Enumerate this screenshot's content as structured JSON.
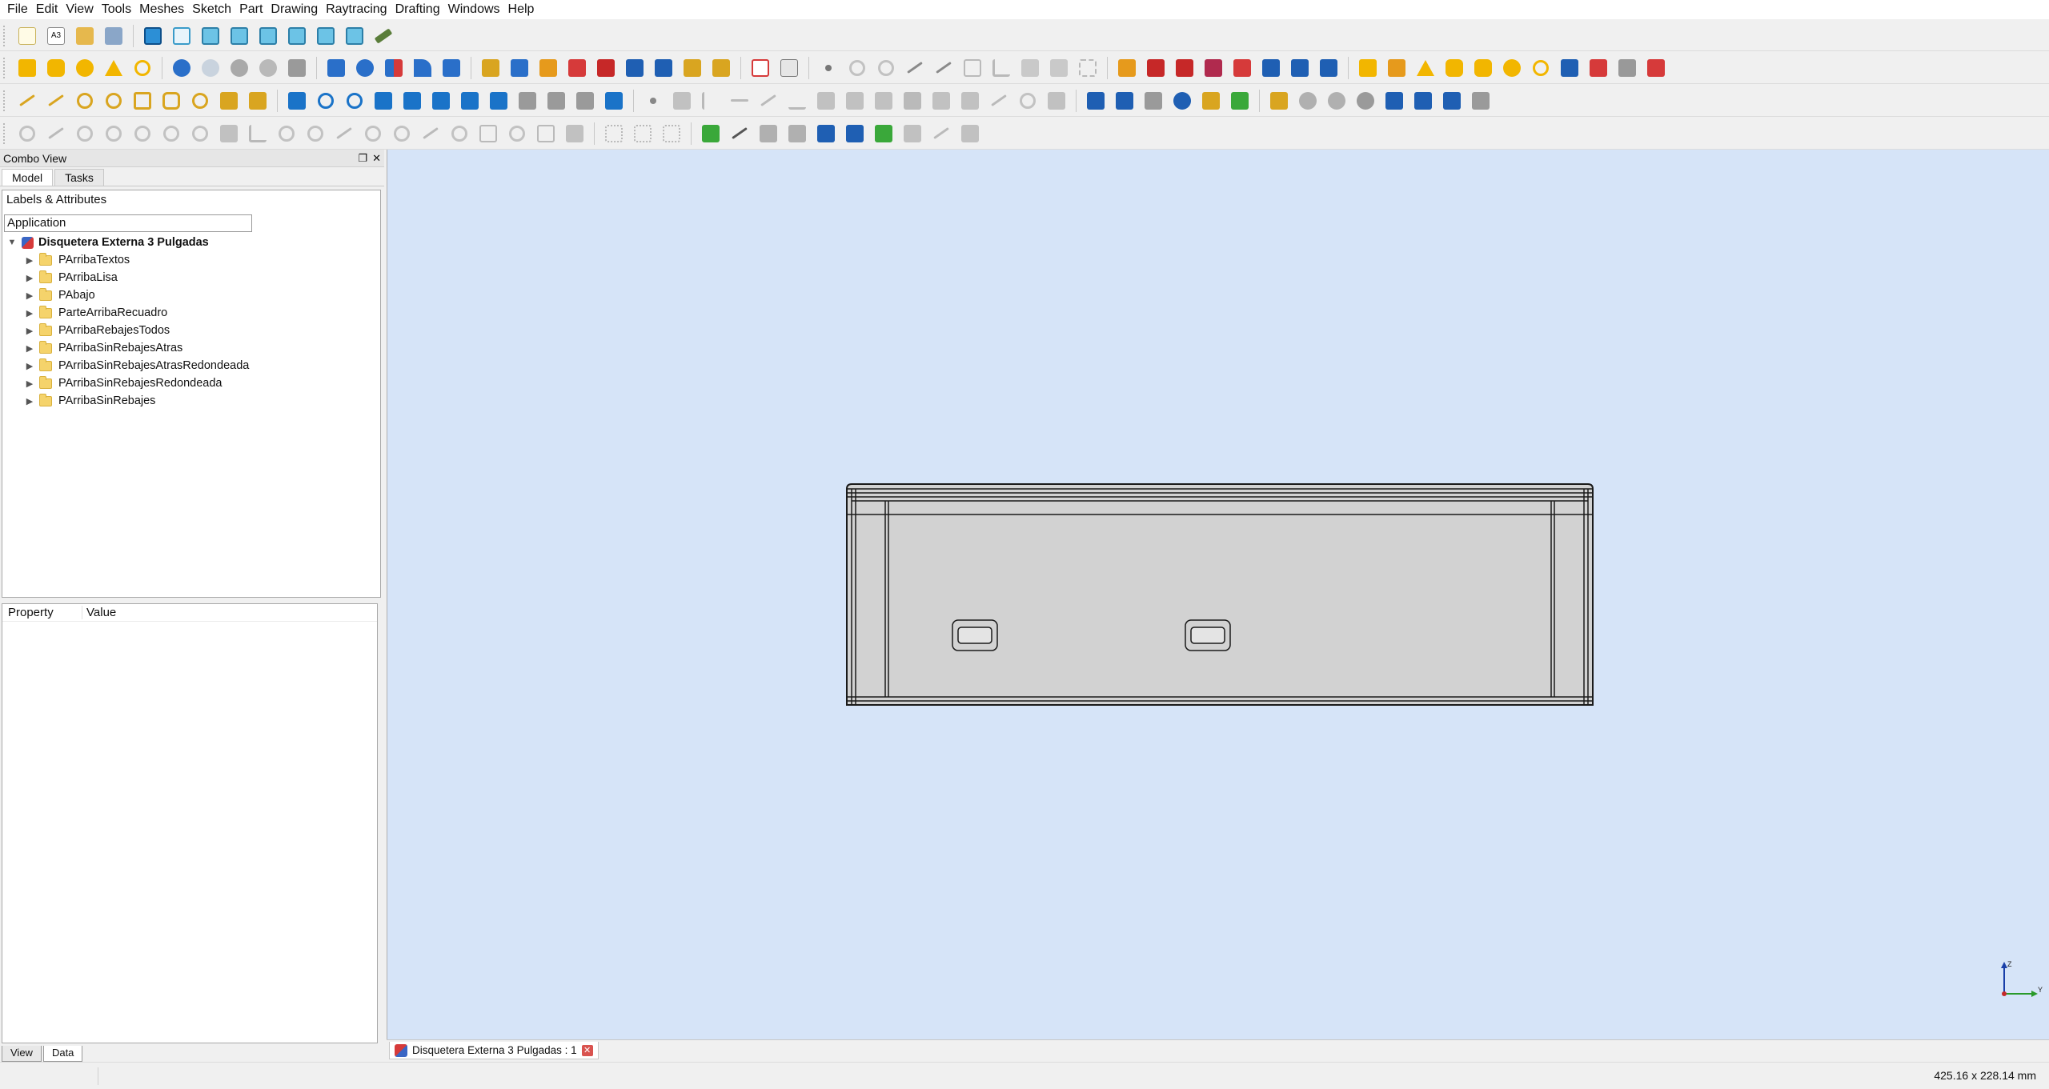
{
  "menu": [
    "File",
    "Edit",
    "View",
    "Tools",
    "Meshes",
    "Sketch",
    "Part",
    "Drawing",
    "Raytracing",
    "Drafting",
    "Windows",
    "Help"
  ],
  "toolbar_std": {
    "a3_label": "A3"
  },
  "combo": {
    "title": "Combo View",
    "tabs": [
      "Model",
      "Tasks"
    ],
    "tree_header": "Labels & Attributes",
    "filter_value": "Application",
    "root_label": "Disquetera Externa 3 Pulgadas",
    "items": [
      "PArribaTextos",
      "PArribaLisa",
      "PAbajo",
      "ParteArribaRecuadro",
      "PArribaRebajesTodos",
      "PArribaSinRebajesAtras",
      "PArribaSinRebajesAtrasRedondeada",
      "PArribaSinRebajesRedondeada",
      "PArribaSinRebajes"
    ],
    "property_col": "Property",
    "value_col": "Value",
    "bottom_tabs": [
      "View",
      "Data"
    ]
  },
  "document_tab": "Disquetera Externa 3 Pulgadas : 1",
  "status": {
    "dimensions": "425.16 x 228.14 mm"
  },
  "axis": {
    "z": "Z",
    "y": "Y"
  },
  "colors": {
    "viewport_bg": "#d6e4f8",
    "model_face": "#d2d2d2",
    "accent_blue": "#1a73c8"
  }
}
